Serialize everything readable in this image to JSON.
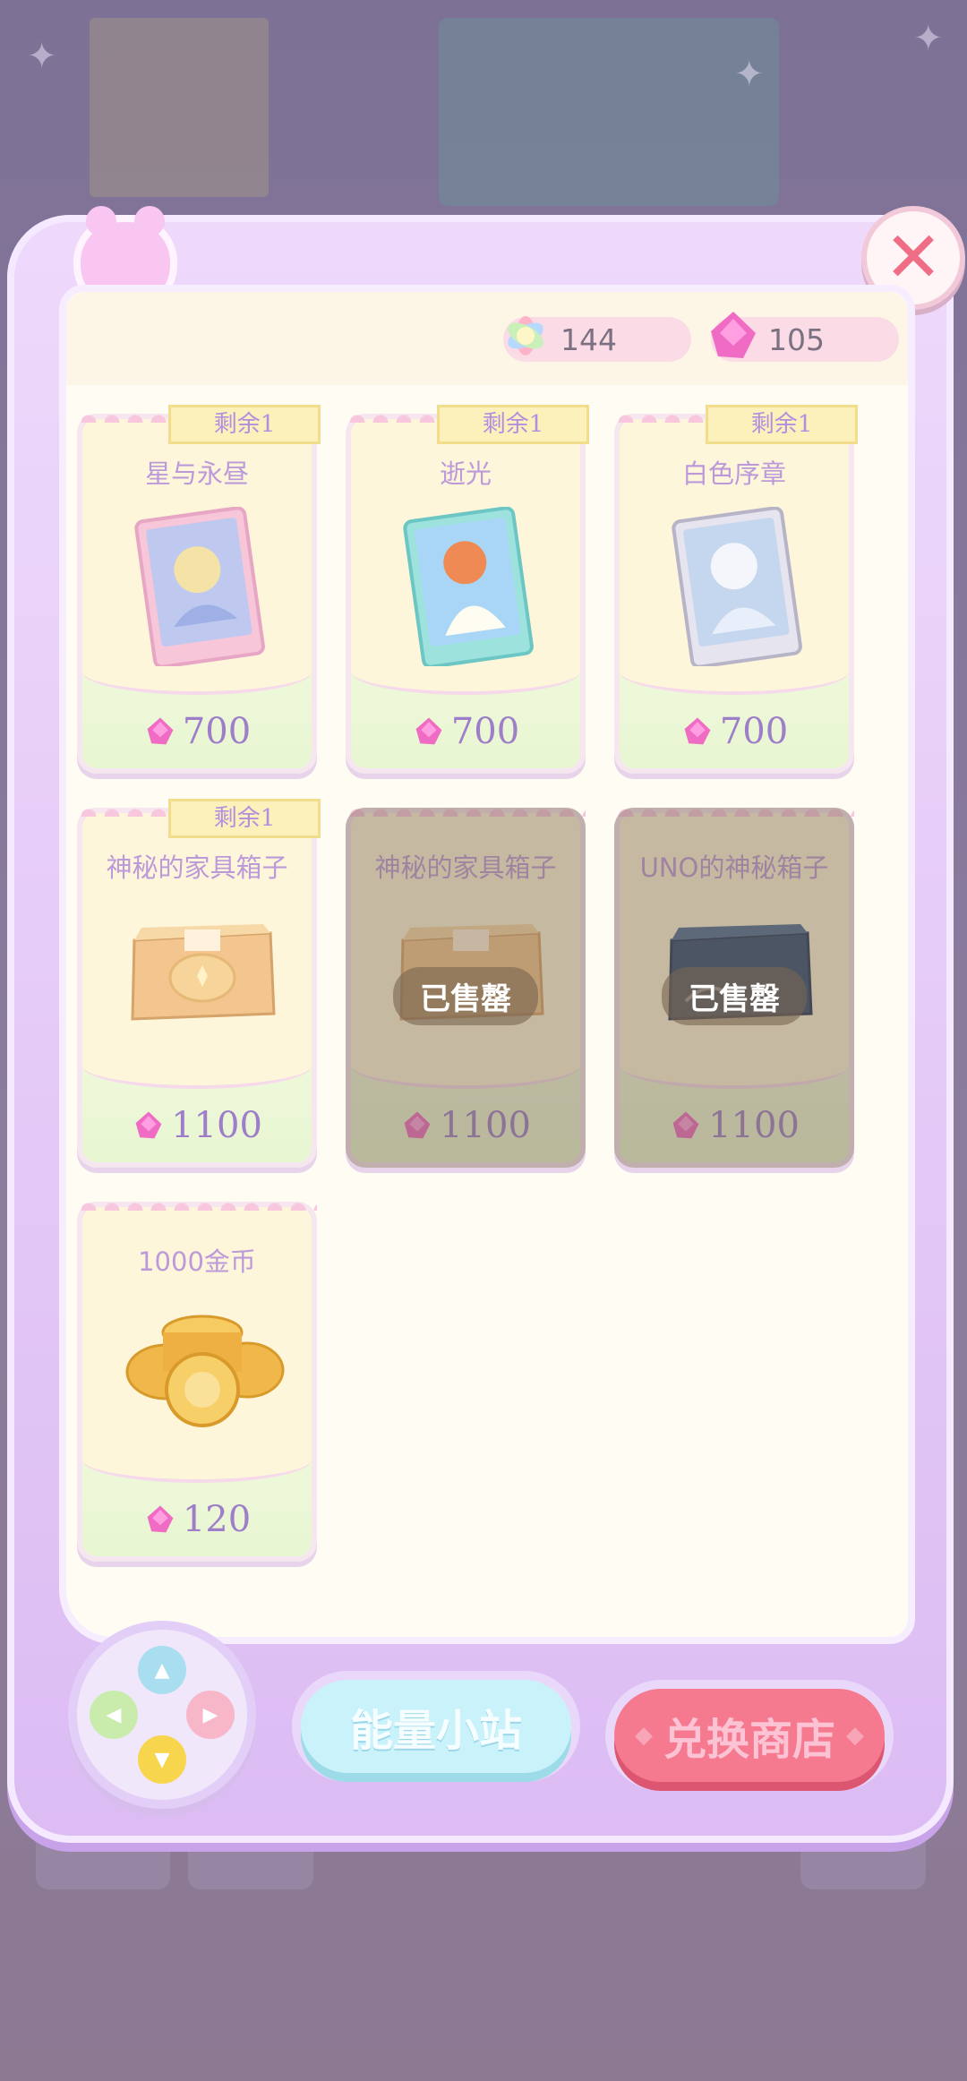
{
  "currency": {
    "rainbow_gem": "144",
    "pink_gem": "105"
  },
  "products": [
    {
      "title": "星与永昼",
      "price": "700",
      "remain": "剩余1",
      "sold": false,
      "kind": "tarot"
    },
    {
      "title": "逝光",
      "price": "700",
      "remain": "剩余1",
      "sold": false,
      "kind": "tarot"
    },
    {
      "title": "白色序章",
      "price": "700",
      "remain": "剩余1",
      "sold": false,
      "kind": "tarot"
    },
    {
      "title": "神秘的家具箱子",
      "price": "1100",
      "remain": "剩余1",
      "sold": false,
      "kind": "box"
    },
    {
      "title": "神秘的家具箱子",
      "price": "1100",
      "remain": "",
      "sold": true,
      "sold_label": "已售罄",
      "kind": "box"
    },
    {
      "title": "UNO的神秘箱子",
      "price": "1100",
      "remain": "",
      "sold": true,
      "sold_label": "已售罄",
      "kind": "uno-box"
    },
    {
      "title": "1000金币",
      "price": "120",
      "remain": "",
      "sold": false,
      "kind": "coins"
    }
  ],
  "buttons": {
    "energy": "能量小站",
    "shop": "兑换商店"
  },
  "icons": {
    "close": "close-icon",
    "rainbow": "rainbow-gem-icon",
    "pink": "pink-gem-icon"
  }
}
